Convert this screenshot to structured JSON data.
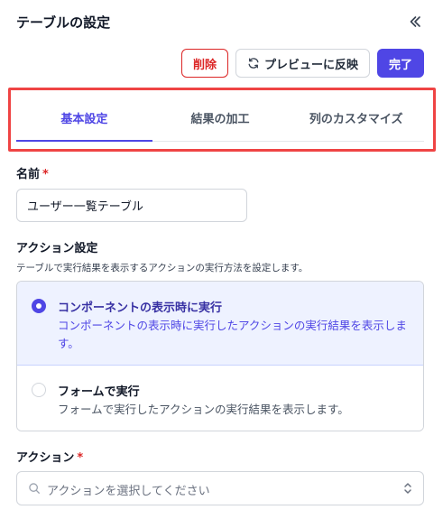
{
  "header": {
    "title": "テーブルの設定",
    "collapse_icon": "double-chevron-left-icon"
  },
  "toolbar": {
    "delete_label": "削除",
    "preview_label": "プレビューに反映",
    "preview_icon": "refresh-icon",
    "done_label": "完了"
  },
  "tabs": [
    {
      "label": "基本設定",
      "active": true
    },
    {
      "label": "結果の加工",
      "active": false
    },
    {
      "label": "列のカスタマイズ",
      "active": false
    }
  ],
  "name_field": {
    "label": "名前",
    "required_mark": "*",
    "value": "ユーザー一覧テーブル"
  },
  "action_setting": {
    "label": "アクション設定",
    "description": "テーブルで実行結果を表示するアクションの実行方法を設定します。",
    "options": [
      {
        "title": "コンポーネントの表示時に実行",
        "description": "コンポーネントの表示時に実行したアクションの実行結果を表示します。",
        "selected": true
      },
      {
        "title": "フォームで実行",
        "description": "フォームで実行したアクションの実行結果を表示します。",
        "selected": false
      }
    ]
  },
  "action_field": {
    "label": "アクション",
    "required_mark": "*",
    "placeholder": "アクションを選択してください",
    "search_icon": "search-icon",
    "chevron_icon": "chevron-up-down-icon"
  },
  "colors": {
    "accent": "#4f46e5",
    "danger": "#dc2626",
    "highlight": "#ef4444",
    "selected_bg": "#eef2ff"
  }
}
